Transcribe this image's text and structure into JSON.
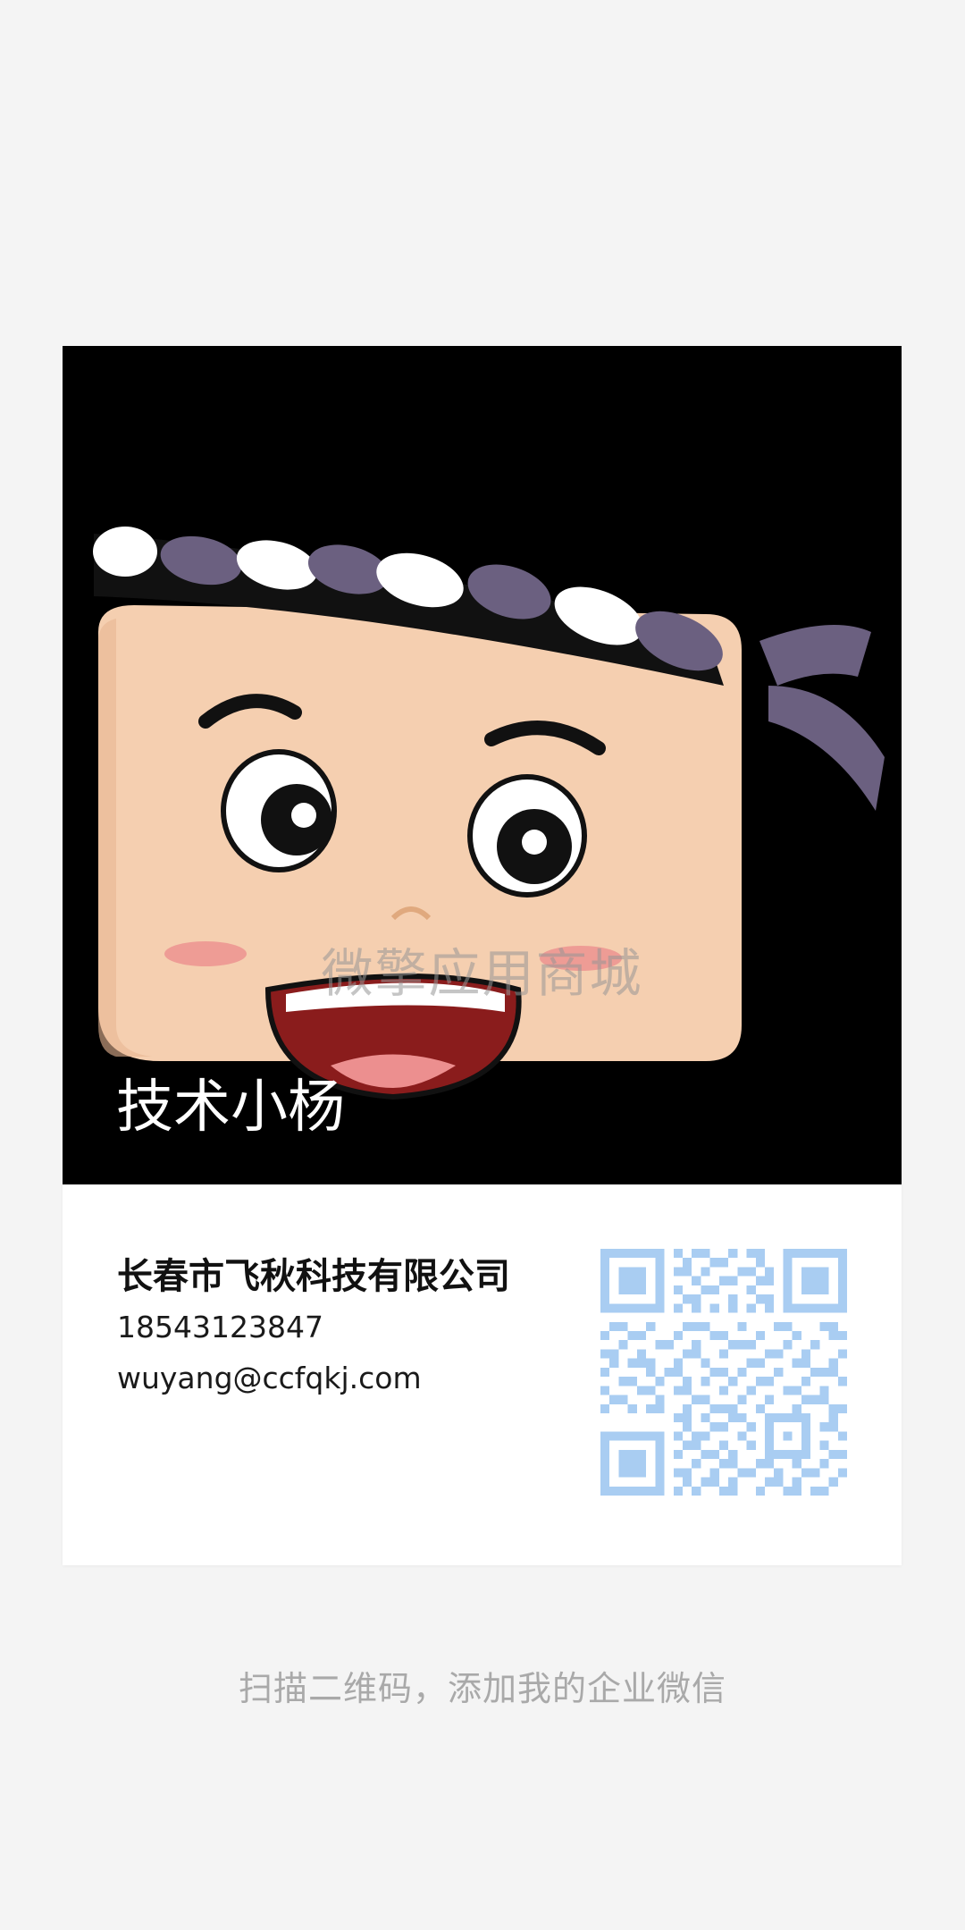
{
  "card": {
    "avatar": {
      "watermark": "微擎应用商城",
      "name": "技术小杨"
    },
    "company": "长春市飞秋科技有限公司",
    "phone": "18543123847",
    "email": "wuyang@ccfqkj.com"
  },
  "hint": "扫描二维码，添加我的企业微信",
  "colors": {
    "page_background": "#f4f4f4",
    "qr_color": "#a9cdf2",
    "avatar_background": "#000000"
  }
}
